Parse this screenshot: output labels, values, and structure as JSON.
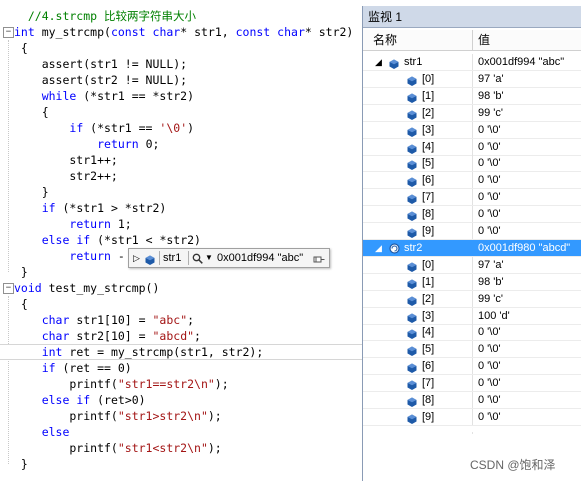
{
  "editor": {
    "lines": [
      {
        "fold": "",
        "tokens": [
          {
            "t": "  //4.strcmp 比较两字符串大小",
            "c": "cmt"
          }
        ]
      },
      {
        "fold": "−",
        "tokens": [
          {
            "t": "int",
            "c": "kw"
          },
          {
            "t": " my_strcmp(",
            "c": ""
          },
          {
            "t": "const",
            "c": "kw"
          },
          {
            "t": " ",
            "c": ""
          },
          {
            "t": "char",
            "c": "kw"
          },
          {
            "t": "* str1, ",
            "c": ""
          },
          {
            "t": "const",
            "c": "kw"
          },
          {
            "t": " ",
            "c": ""
          },
          {
            "t": "char",
            "c": "kw"
          },
          {
            "t": "* str2)",
            "c": ""
          }
        ]
      },
      {
        "fold": "",
        "tokens": [
          {
            "t": " {",
            "c": ""
          }
        ]
      },
      {
        "fold": "",
        "tokens": [
          {
            "t": "    assert(str1 != NULL);",
            "c": ""
          }
        ]
      },
      {
        "fold": "",
        "tokens": [
          {
            "t": "    assert(str2 != NULL);",
            "c": ""
          }
        ]
      },
      {
        "fold": "",
        "tokens": [
          {
            "t": "    ",
            "c": ""
          },
          {
            "t": "while",
            "c": "kw"
          },
          {
            "t": " (*str1 == *str2)",
            "c": ""
          }
        ]
      },
      {
        "fold": "",
        "tokens": [
          {
            "t": "    {",
            "c": ""
          }
        ]
      },
      {
        "fold": "",
        "tokens": [
          {
            "t": "        ",
            "c": ""
          },
          {
            "t": "if",
            "c": "kw"
          },
          {
            "t": " (*str1 == ",
            "c": ""
          },
          {
            "t": "'\\0'",
            "c": "str"
          },
          {
            "t": ")",
            "c": ""
          }
        ]
      },
      {
        "fold": "",
        "tokens": [
          {
            "t": "            ",
            "c": ""
          },
          {
            "t": "return",
            "c": "kw"
          },
          {
            "t": " 0;",
            "c": ""
          }
        ]
      },
      {
        "fold": "",
        "tokens": [
          {
            "t": "        str1++;",
            "c": ""
          }
        ]
      },
      {
        "fold": "",
        "tokens": [
          {
            "t": "        str2++;",
            "c": ""
          }
        ]
      },
      {
        "fold": "",
        "tokens": [
          {
            "t": "    }",
            "c": ""
          }
        ]
      },
      {
        "fold": "",
        "tokens": [
          {
            "t": "    ",
            "c": ""
          },
          {
            "t": "if",
            "c": "kw"
          },
          {
            "t": " (*str1 > *str2)",
            "c": ""
          }
        ]
      },
      {
        "fold": "",
        "tokens": [
          {
            "t": "        ",
            "c": ""
          },
          {
            "t": "return",
            "c": "kw"
          },
          {
            "t": " 1;",
            "c": ""
          }
        ]
      },
      {
        "fold": "",
        "tokens": [
          {
            "t": "    ",
            "c": ""
          },
          {
            "t": "else",
            "c": "kw"
          },
          {
            "t": " ",
            "c": ""
          },
          {
            "t": "if",
            "c": "kw"
          },
          {
            "t": " (*str1 < *str2)",
            "c": ""
          }
        ]
      },
      {
        "fold": "",
        "tokens": [
          {
            "t": "        ",
            "c": ""
          },
          {
            "t": "return",
            "c": "kw"
          },
          {
            "t": " -",
            "c": ""
          }
        ]
      },
      {
        "fold": "",
        "tokens": [
          {
            "t": " }",
            "c": ""
          }
        ]
      },
      {
        "fold": "−",
        "tokens": [
          {
            "t": "void",
            "c": "kw"
          },
          {
            "t": " test_my_strcmp()",
            "c": ""
          }
        ]
      },
      {
        "fold": "",
        "tokens": [
          {
            "t": " {",
            "c": ""
          }
        ]
      },
      {
        "fold": "",
        "tokens": [
          {
            "t": "    ",
            "c": ""
          },
          {
            "t": "char",
            "c": "kw"
          },
          {
            "t": " str1[10] = ",
            "c": ""
          },
          {
            "t": "\"abc\"",
            "c": "str"
          },
          {
            "t": ";",
            "c": ""
          }
        ]
      },
      {
        "fold": "",
        "tokens": [
          {
            "t": "    ",
            "c": ""
          },
          {
            "t": "char",
            "c": "kw"
          },
          {
            "t": " str2[10] = ",
            "c": ""
          },
          {
            "t": "\"abcd\"",
            "c": "str"
          },
          {
            "t": ";",
            "c": ""
          }
        ]
      },
      {
        "fold": "",
        "tokens": [
          {
            "t": "    ",
            "c": ""
          },
          {
            "t": "int",
            "c": "kw"
          },
          {
            "t": " ret = my_strcmp(str1, str2);",
            "c": ""
          }
        ]
      },
      {
        "fold": "",
        "tokens": [
          {
            "t": "    ",
            "c": ""
          },
          {
            "t": "if",
            "c": "kw"
          },
          {
            "t": " (ret == 0)",
            "c": ""
          }
        ]
      },
      {
        "fold": "",
        "tokens": [
          {
            "t": "        printf(",
            "c": ""
          },
          {
            "t": "\"str1==str2\\n\"",
            "c": "str"
          },
          {
            "t": ");",
            "c": ""
          }
        ]
      },
      {
        "fold": "",
        "tokens": [
          {
            "t": "    ",
            "c": ""
          },
          {
            "t": "else",
            "c": "kw"
          },
          {
            "t": " ",
            "c": ""
          },
          {
            "t": "if",
            "c": "kw"
          },
          {
            "t": " (ret>0)",
            "c": ""
          }
        ]
      },
      {
        "fold": "",
        "tokens": [
          {
            "t": "        printf(",
            "c": ""
          },
          {
            "t": "\"str1>str2\\n\"",
            "c": "str"
          },
          {
            "t": ");",
            "c": ""
          }
        ]
      },
      {
        "fold": "",
        "tokens": [
          {
            "t": "    ",
            "c": ""
          },
          {
            "t": "else",
            "c": "kw"
          },
          {
            "t": "",
            "c": ""
          }
        ]
      },
      {
        "fold": "",
        "tokens": [
          {
            "t": "        printf(",
            "c": ""
          },
          {
            "t": "\"str1<str2\\n\"",
            "c": "str"
          },
          {
            "t": ");",
            "c": ""
          }
        ]
      },
      {
        "fold": "",
        "tokens": [
          {
            "t": " }",
            "c": ""
          }
        ]
      }
    ]
  },
  "datatip": {
    "pin_icon": "pin-icon",
    "name": "str1",
    "value": "0x001df994 \"abc\"",
    "expand_icon": "expand-triangle-icon",
    "search_icon": "magnifier-icon",
    "dropdown_icon": "dropdown-arrow-icon"
  },
  "watch": {
    "title": "监视 1",
    "col_name": "名称",
    "col_value": "值",
    "rows": [
      {
        "level": 0,
        "expander": "◢",
        "name": "str1",
        "value": "0x001df994 \"abc\"",
        "selected": false,
        "icon": "variable-cube-icon"
      },
      {
        "level": 1,
        "expander": "",
        "name": "[0]",
        "value": "97 'a'",
        "selected": false,
        "icon": "variable-cube-icon"
      },
      {
        "level": 1,
        "expander": "",
        "name": "[1]",
        "value": "98 'b'",
        "selected": false,
        "icon": "variable-cube-icon"
      },
      {
        "level": 1,
        "expander": "",
        "name": "[2]",
        "value": "99 'c'",
        "selected": false,
        "icon": "variable-cube-icon"
      },
      {
        "level": 1,
        "expander": "",
        "name": "[3]",
        "value": "0 '\\0'",
        "selected": false,
        "icon": "variable-cube-icon"
      },
      {
        "level": 1,
        "expander": "",
        "name": "[4]",
        "value": "0 '\\0'",
        "selected": false,
        "icon": "variable-cube-icon"
      },
      {
        "level": 1,
        "expander": "",
        "name": "[5]",
        "value": "0 '\\0'",
        "selected": false,
        "icon": "variable-cube-icon"
      },
      {
        "level": 1,
        "expander": "",
        "name": "[6]",
        "value": "0 '\\0'",
        "selected": false,
        "icon": "variable-cube-icon"
      },
      {
        "level": 1,
        "expander": "",
        "name": "[7]",
        "value": "0 '\\0'",
        "selected": false,
        "icon": "variable-cube-icon"
      },
      {
        "level": 1,
        "expander": "",
        "name": "[8]",
        "value": "0 '\\0'",
        "selected": false,
        "icon": "variable-cube-icon"
      },
      {
        "level": 1,
        "expander": "",
        "name": "[9]",
        "value": "0 '\\0'",
        "selected": false,
        "icon": "variable-cube-icon"
      },
      {
        "level": 0,
        "expander": "◢",
        "name": "str2",
        "value": "0x001df980 \"abcd\"",
        "selected": true,
        "icon": "variable-refresh-icon"
      },
      {
        "level": 1,
        "expander": "",
        "name": "[0]",
        "value": "97 'a'",
        "selected": false,
        "icon": "variable-cube-icon"
      },
      {
        "level": 1,
        "expander": "",
        "name": "[1]",
        "value": "98 'b'",
        "selected": false,
        "icon": "variable-cube-icon"
      },
      {
        "level": 1,
        "expander": "",
        "name": "[2]",
        "value": "99 'c'",
        "selected": false,
        "icon": "variable-cube-icon"
      },
      {
        "level": 1,
        "expander": "",
        "name": "[3]",
        "value": "100 'd'",
        "selected": false,
        "icon": "variable-cube-icon"
      },
      {
        "level": 1,
        "expander": "",
        "name": "[4]",
        "value": "0 '\\0'",
        "selected": false,
        "icon": "variable-cube-icon"
      },
      {
        "level": 1,
        "expander": "",
        "name": "[5]",
        "value": "0 '\\0'",
        "selected": false,
        "icon": "variable-cube-icon"
      },
      {
        "level": 1,
        "expander": "",
        "name": "[6]",
        "value": "0 '\\0'",
        "selected": false,
        "icon": "variable-cube-icon"
      },
      {
        "level": 1,
        "expander": "",
        "name": "[7]",
        "value": "0 '\\0'",
        "selected": false,
        "icon": "variable-cube-icon"
      },
      {
        "level": 1,
        "expander": "",
        "name": "[8]",
        "value": "0 '\\0'",
        "selected": false,
        "icon": "variable-cube-icon"
      },
      {
        "level": 1,
        "expander": "",
        "name": "[9]",
        "value": "0 '\\0'",
        "selected": false,
        "icon": "variable-cube-icon"
      }
    ]
  },
  "watermark": "CSDN @饱和泽",
  "colors": {
    "keyword": "#0000ff",
    "string": "#a31515",
    "comment": "#008000",
    "selection": "#3399ff",
    "watch_title_bar": "#cfd9e8",
    "variable_icon": "#1e5aa8"
  }
}
